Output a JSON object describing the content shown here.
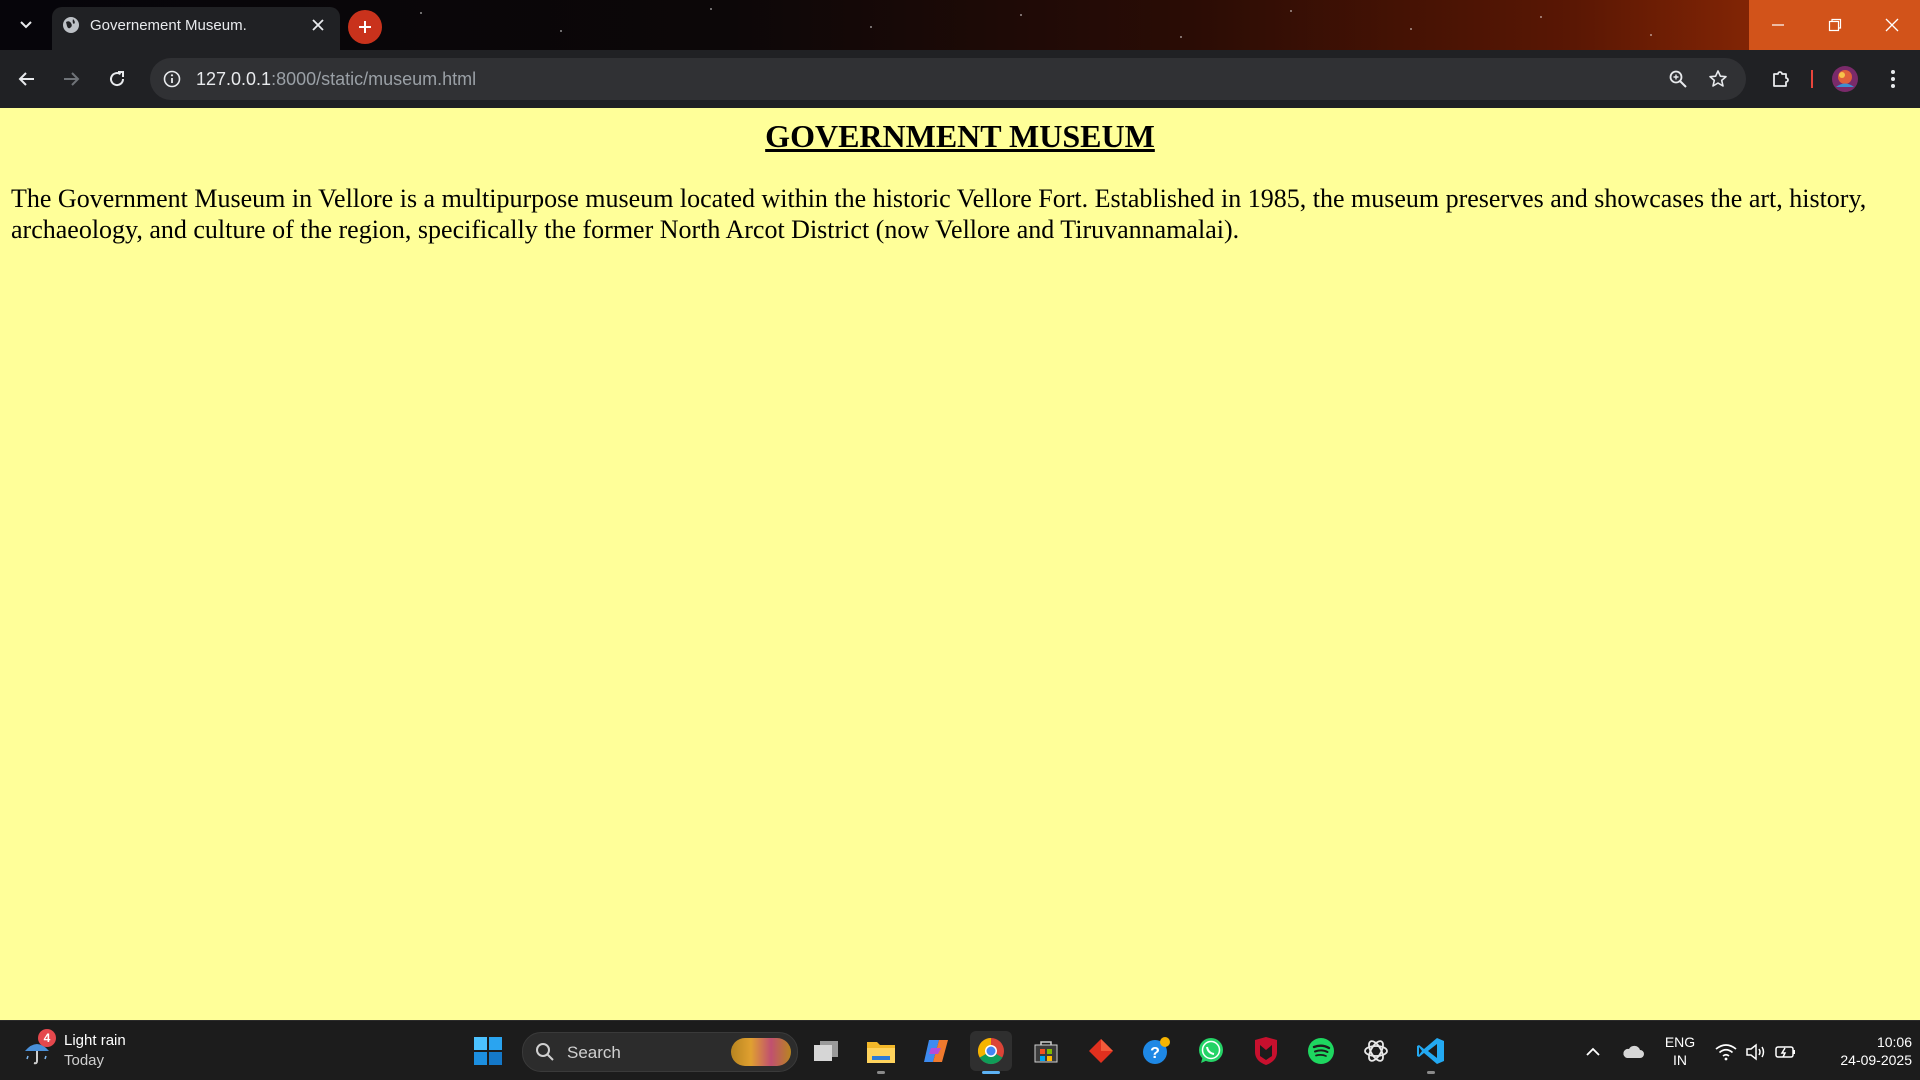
{
  "browser": {
    "tab": {
      "title": "Governement Museum.",
      "favicon_icon": "globe-icon"
    },
    "address_bar": {
      "host": "127.0.0.1",
      "rest": ":8000/static/museum.html"
    },
    "accent_color": "#c9321c"
  },
  "page": {
    "background_color": "#ffff99",
    "heading": "GOVERNMENT MUSEUM",
    "paragraph": "The Government Museum in Vellore is a multipurpose museum located within the historic Vellore Fort. Established in 1985, the museum preserves and showcases the art, history, archaeology, and culture of the region, specifically the former North Arcot District (now Vellore and Tiruvannamalai)."
  },
  "taskbar": {
    "weather": {
      "badge": "4",
      "condition": "Light rain",
      "day": "Today"
    },
    "search_label": "Search",
    "language": {
      "line1": "ENG",
      "line2": "IN"
    },
    "clock": {
      "time": "10:06",
      "date": "24-09-2025"
    }
  }
}
